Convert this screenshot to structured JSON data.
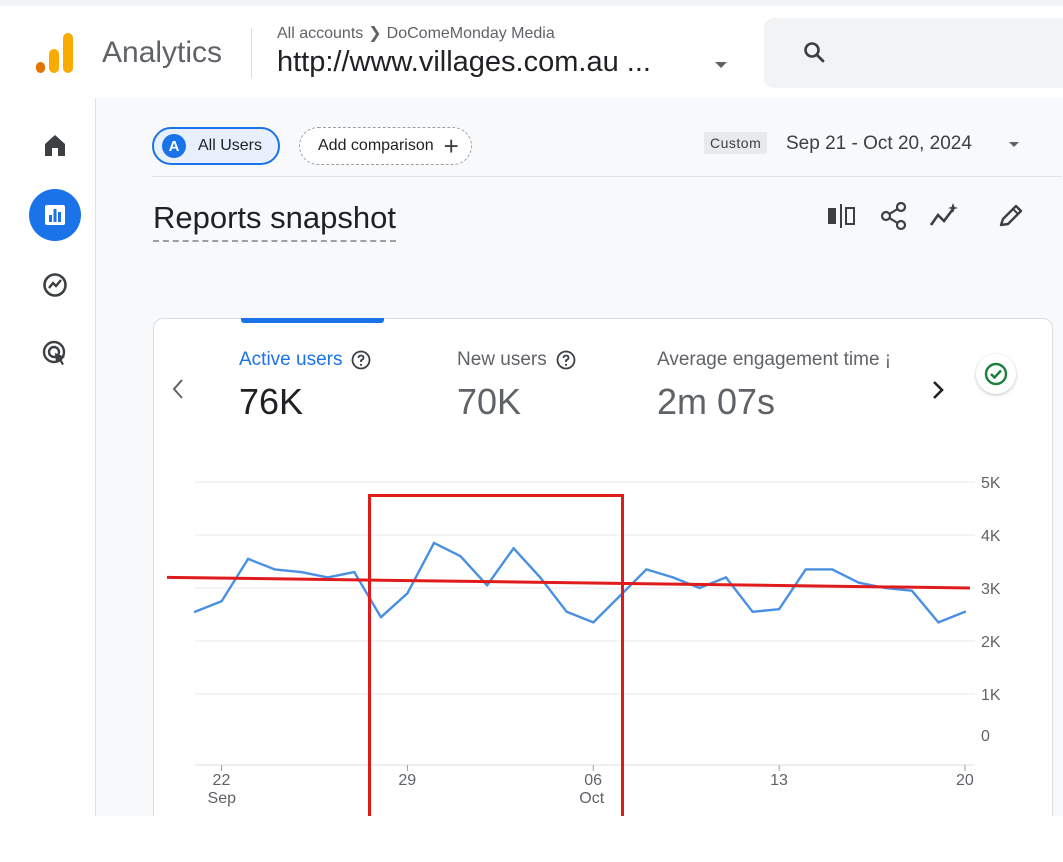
{
  "header": {
    "app_name": "Analytics",
    "breadcrumb_account": "All accounts",
    "breadcrumb_sub": "DoComeMonday Media",
    "property": "http://www.villages.com.au ..."
  },
  "toolbar": {
    "chip_avatar": "A",
    "chip_users": "All Users",
    "add_comparison": "Add comparison",
    "date_tag": "Custom",
    "date_range": "Sep 21 - Oct 20, 2024"
  },
  "page": {
    "title": "Reports snapshot"
  },
  "metrics": [
    {
      "label": "Active users",
      "value": "76K",
      "active": true
    },
    {
      "label": "New users",
      "value": "70K",
      "active": false
    },
    {
      "label": "Average engagement time ¡",
      "value": "2m 07s",
      "active": false
    }
  ],
  "icons": {
    "nav": [
      "home-icon",
      "reports-icon",
      "explore-icon",
      "advertising-icon"
    ],
    "tools": [
      "compare-icon",
      "share-icon",
      "insights-icon",
      "edit-icon"
    ]
  },
  "colors": {
    "accent": "#1a73e8",
    "line": "#4a90e2",
    "trend": "#e01b1b",
    "check": "#188038"
  },
  "chart_data": {
    "type": "line",
    "x": [
      "Sep 21",
      "Sep 22",
      "Sep 23",
      "Sep 24",
      "Sep 25",
      "Sep 26",
      "Sep 27",
      "Sep 28",
      "Sep 29",
      "Sep 30",
      "Oct 01",
      "Oct 02",
      "Oct 03",
      "Oct 04",
      "Oct 05",
      "Oct 06",
      "Oct 07",
      "Oct 08",
      "Oct 09",
      "Oct 10",
      "Oct 11",
      "Oct 12",
      "Oct 13",
      "Oct 14",
      "Oct 15",
      "Oct 16",
      "Oct 17",
      "Oct 18",
      "Oct 19",
      "Oct 20"
    ],
    "x_tick_labels": [
      {
        "index": 1,
        "day": "22",
        "month": "Sep"
      },
      {
        "index": 8,
        "day": "29",
        "month": ""
      },
      {
        "index": 15,
        "day": "06",
        "month": "Oct"
      },
      {
        "index": 22,
        "day": "13",
        "month": ""
      },
      {
        "index": 29,
        "day": "20",
        "month": ""
      }
    ],
    "series": [
      {
        "values": [
          2550,
          2750,
          3550,
          3350,
          3300,
          3200,
          3300,
          2450,
          2900,
          3850,
          3600,
          3050,
          3750,
          3200,
          2550,
          2350,
          2850,
          3350,
          3200,
          3000,
          3200,
          2550,
          2600,
          3350,
          3350,
          3100,
          3000,
          2950,
          2350,
          2550
        ]
      }
    ],
    "trend_line": {
      "start": 3200,
      "end": 3000
    },
    "y_ticks": [
      "5K",
      "4K",
      "3K",
      "2K",
      "1K",
      "0"
    ],
    "y_tick_values": [
      5000,
      4000,
      3000,
      2000,
      1000,
      0
    ],
    "ylim": [
      0,
      5000
    ],
    "grid": true,
    "y_axis_side": "right"
  }
}
